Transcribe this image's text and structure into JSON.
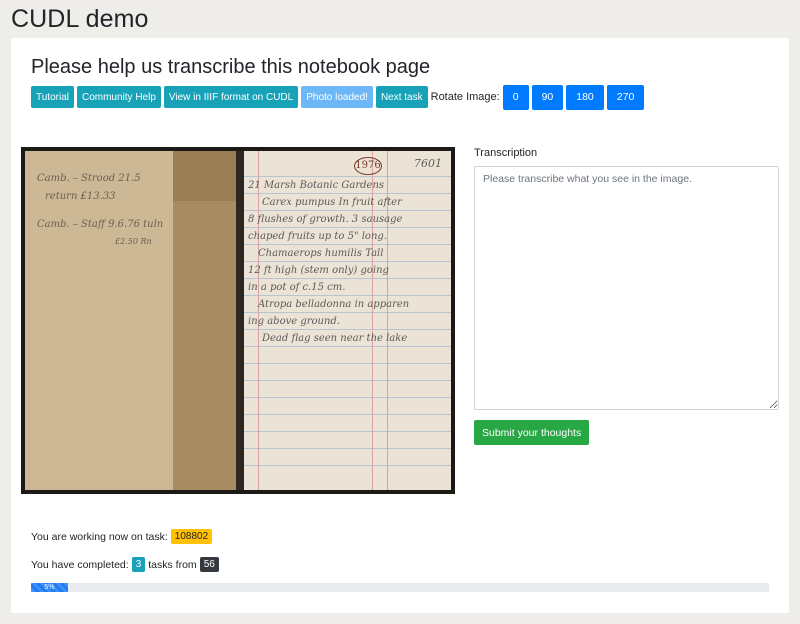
{
  "app": {
    "title": "CUDL demo"
  },
  "page": {
    "title": "Please help us transcribe this notebook page"
  },
  "toolbar": {
    "tutorial": "Tutorial",
    "community_help": "Community Help",
    "view_iiif": "View in IIIF format on CUDL",
    "photo_loaded": "Photo loaded!",
    "next_task": "Next task",
    "rotate_label": "Rotate Image:",
    "rotate_options": [
      "0",
      "90",
      "180",
      "270"
    ]
  },
  "image": {
    "stamp": "1976",
    "page_number": "7601",
    "left_page_notes": [
      "Camb. – Strood 21.5",
      "return £13.33",
      "Camb. – Staff 9.6.76 tuln",
      "£2.50 Rn"
    ],
    "right_page_notes": [
      "21  Marsh  Botanic  Gardens",
      "Carex  pumpus  In fruit  after",
      "8 flushes of growth. 3  sausage",
      "chaped fruits  up  to 5\" long.",
      "Chamaerops humilis  Tall",
      "12 ft high (stem only) going",
      "in a pot of c.15 cm.",
      "Atropa  belladonna  in apparen",
      "ing above ground.",
      "Dead flag  seen  near the lake"
    ]
  },
  "transcription": {
    "label": "Transcription",
    "value": "",
    "placeholder": "Please transcribe what you see in the image.",
    "submit_label": "Submit your thoughts"
  },
  "status": {
    "working_prefix": "You are working now on task:",
    "task_id": "108802",
    "completed_prefix": "You have completed:",
    "completed_count": "3",
    "tasks_from": "tasks from",
    "total_tasks": "56",
    "progress_label": "5%",
    "progress_percent": 5
  },
  "colors": {
    "info": "#17a2b8",
    "primary": "#007bff",
    "success": "#28a745",
    "warning": "#ffc107",
    "dark": "#343a40",
    "background": "#efedea"
  }
}
